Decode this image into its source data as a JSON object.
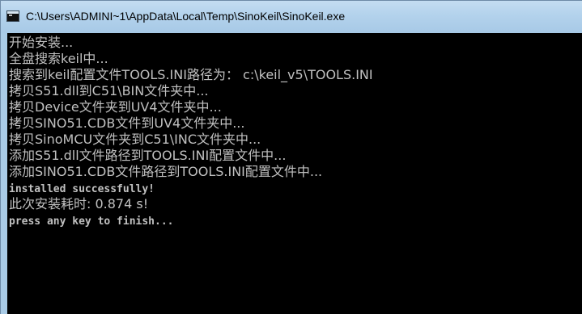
{
  "window": {
    "title": "C:\\Users\\ADMINI~1\\AppData\\Local\\Temp\\SinoKeil\\SinoKeil.exe",
    "icon": "console-app-icon"
  },
  "console": {
    "background": "#000000",
    "foreground": "#c0c0c0",
    "lines": [
      "开始安装...",
      "全盘搜索keil中...",
      "搜索到keil配置文件TOOLS.INI路径为： c:\\keil_v5\\TOOLS.INI",
      "拷贝S51.dll到C51\\BIN文件夹中...",
      "拷贝Device文件夹到UV4文件夹中...",
      "拷贝SINO51.CDB文件到UV4文件夹中...",
      "拷贝SinoMCU文件夹到C51\\INC文件夹中...",
      "添加S51.dll文件路径到TOOLS.INI配置文件中...",
      "添加SINO51.CDB文件路径到TOOLS.INI配置文件中...",
      "installed successfully!",
      "此次安装耗时: 0.874 s!",
      "press any key to finish..."
    ]
  }
}
